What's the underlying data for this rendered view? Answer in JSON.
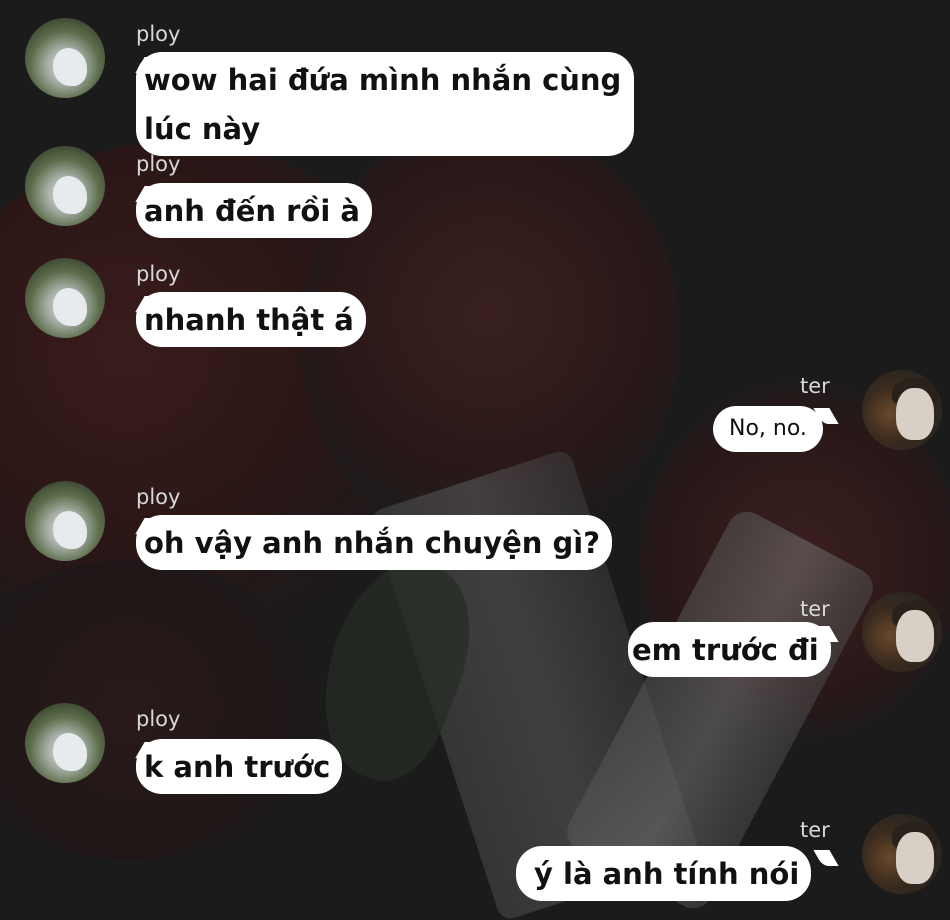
{
  "chat": {
    "messages": [
      {
        "sender": "ploy",
        "side": "left",
        "text": "wow hai đứa mình nhắn cùng lúc này"
      },
      {
        "sender": "ploy",
        "side": "left",
        "text": "anh đến rồi à"
      },
      {
        "sender": "ploy",
        "side": "left",
        "text": "nhanh thật á"
      },
      {
        "sender": "ter",
        "side": "right",
        "text": "No, no."
      },
      {
        "sender": "ploy",
        "side": "left",
        "text": "oh vậy anh nhắn chuyện gì?"
      },
      {
        "sender": "ter",
        "side": "right",
        "text": "em trước đi"
      },
      {
        "sender": "ploy",
        "side": "left",
        "text": "k anh trước"
      },
      {
        "sender": "ter",
        "side": "right",
        "text": "ý là anh tính nói"
      }
    ]
  },
  "colors": {
    "background": "#1b1b1c",
    "bubble": "#ffffff",
    "name_text": "#d8d8d8",
    "message_text": "#111111"
  }
}
